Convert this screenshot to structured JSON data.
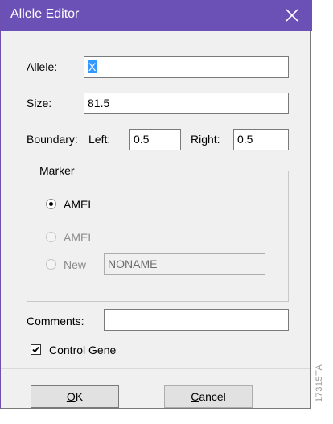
{
  "window": {
    "title": "Allele Editor"
  },
  "allele": {
    "label": "Allele:",
    "value": "X"
  },
  "size": {
    "label": "Size:",
    "value": "81.5"
  },
  "boundary": {
    "label": "Boundary:",
    "left_label": "Left:",
    "left_value": "0.5",
    "right_label": "Right:",
    "right_value": "0.5"
  },
  "marker": {
    "group_label": "Marker",
    "options": [
      {
        "label": "AMEL",
        "checked": true,
        "enabled": true
      },
      {
        "label": "AMEL",
        "checked": false,
        "enabled": false
      },
      {
        "label": "New",
        "checked": false,
        "enabled": false
      }
    ],
    "new_name_value": "NONAME"
  },
  "comments": {
    "label": "Comments:",
    "value": ""
  },
  "control_gene": {
    "label": "Control Gene",
    "checked": true
  },
  "buttons": {
    "ok_mnemonic": "O",
    "ok_rest": "K",
    "cancel_mnemonic": "C",
    "cancel_rest": "ancel"
  },
  "figure_id": "17315TA",
  "colors": {
    "titlebar": "#6b50b6",
    "selection": "#3399ff",
    "dialog_bg": "#f0f0f0"
  },
  "icons": {
    "close": "close-icon",
    "checkbox_mark": "checkmark-icon"
  }
}
